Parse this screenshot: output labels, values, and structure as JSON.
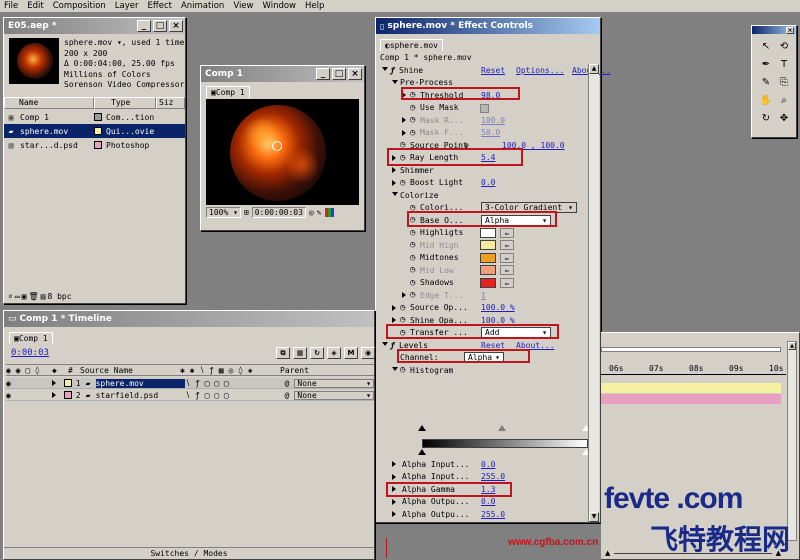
{
  "menu": [
    "File",
    "Edit",
    "Composition",
    "Layer",
    "Effect",
    "Animation",
    "View",
    "Window",
    "Help"
  ],
  "project": {
    "title": "E05.aep *",
    "info": [
      "sphere.mov ▾, used 1 time",
      "200 x 200",
      "Δ 0:00:04:00, 25.00 fps",
      "Millions of Colors",
      "Sorenson Video Compressor"
    ],
    "col_name": "Name",
    "col_type": "Type",
    "col_size": "Siz",
    "items": [
      {
        "name": "Comp 1",
        "type": "Com...tion",
        "swatch": "#9a9a9a"
      },
      {
        "name": "sphere.mov",
        "type": "Qui...ovie",
        "swatch": "#f5f0a0"
      },
      {
        "name": "star...d.psd",
        "type": "Photoshop",
        "swatch": "#e8a0c0"
      }
    ],
    "bpc": "8 bpc"
  },
  "comp": {
    "title": "Comp 1",
    "tab": "Comp 1",
    "zoom": "100%",
    "time": "0:00:00:03"
  },
  "effects": {
    "title": "sphere.mov * Effect Controls",
    "tab": "sphere.mov",
    "path": "Comp 1 * sphere.mov",
    "rows": [
      {
        "lvl": 0,
        "exp": "down",
        "fx": true,
        "label": "Shine",
        "links": [
          "Reset",
          "Options...",
          "About..."
        ]
      },
      {
        "lvl": 1,
        "exp": "down",
        "label": "Pre-Process"
      },
      {
        "lvl": 2,
        "exp": "right",
        "sw": true,
        "label": "Threshold",
        "value": "98.0",
        "vx": 88
      },
      {
        "lvl": 2,
        "sw": true,
        "label": "Use Mask",
        "check": true
      },
      {
        "lvl": 2,
        "exp": "right",
        "sw": true,
        "label": "Mask R...",
        "value": "100.0",
        "vx": 88,
        "dim": true
      },
      {
        "lvl": 2,
        "exp": "right",
        "sw": true,
        "label": "Mask F...",
        "value": "50.0",
        "vx": 88,
        "dim": true
      },
      {
        "lvl": 1,
        "sw": true,
        "label": "Source Point",
        "value": "100.0 , 100.0",
        "vx": 107,
        "cross": true
      },
      {
        "lvl": 1,
        "exp": "right",
        "sw": true,
        "label": "Ray Length",
        "value": "5.4",
        "vx": 88
      },
      {
        "lvl": 1,
        "exp": "right",
        "label": "Shimmer"
      },
      {
        "lvl": 1,
        "exp": "right",
        "sw": true,
        "label": "Boost Light",
        "value": "0.0",
        "vx": 88
      },
      {
        "lvl": 1,
        "exp": "down",
        "label": "Colorize"
      },
      {
        "lvl": 2,
        "sw": true,
        "label": "Colori...",
        "dd": "3-Color Gradient",
        "ddw": 96
      },
      {
        "lvl": 2,
        "sw": true,
        "label": "Base O...",
        "dd": "Alpha",
        "ddw": 70
      },
      {
        "lvl": 2,
        "sw": true,
        "label": "Highligts",
        "color": "#ffffff"
      },
      {
        "lvl": 2,
        "sw": true,
        "label": "Mid High",
        "color": "#f8e8a0",
        "dim": true
      },
      {
        "lvl": 2,
        "sw": true,
        "label": "Midtones",
        "color": "#f0a020"
      },
      {
        "lvl": 2,
        "sw": true,
        "label": "Mid Low",
        "color": "#f0a078",
        "dim": true
      },
      {
        "lvl": 2,
        "sw": true,
        "label": "Shadows",
        "color": "#e82020"
      },
      {
        "lvl": 2,
        "exp": "right",
        "sw": true,
        "label": "Edge T...",
        "value": "1",
        "vx": 88,
        "dim": true
      },
      {
        "lvl": 1,
        "exp": "right",
        "sw": true,
        "label": "Source Op...",
        "value": "100.0 %",
        "vx": 88
      },
      {
        "lvl": 1,
        "exp": "right",
        "sw": true,
        "label": "Shine Opa...",
        "value": "100.0 %",
        "vx": 88
      },
      {
        "lvl": 1,
        "sw": true,
        "label": "Transfer ...",
        "dd": "Add",
        "ddw": 70
      },
      {
        "lvl": 0,
        "exp": "down",
        "fx": true,
        "label": "Levels",
        "links": [
          "Reset",
          "About..."
        ]
      },
      {
        "lvl": 1,
        "label": "Channel:",
        "dd": "Alpha",
        "ddw": 40,
        "ddx": 88
      },
      {
        "lvl": 1,
        "exp": "down",
        "sw": true,
        "label": "Histogram"
      }
    ],
    "bottom_rows": [
      {
        "label": "Alpha Input...",
        "value": "0.0"
      },
      {
        "label": "Alpha Input...",
        "value": "255.0"
      },
      {
        "label": "Alpha Gamma",
        "value": "1.3"
      },
      {
        "label": "Alpha Outpu...",
        "value": "0.0"
      },
      {
        "label": "Alpha Outpu...",
        "value": "255.0"
      }
    ]
  },
  "timeline": {
    "title": "Comp 1 * Timeline",
    "tab": "Comp 1",
    "time": "0:00:03",
    "col_num": "#",
    "col_source": "Source Name",
    "col_parent": "Parent",
    "layers": [
      {
        "num": "1",
        "name": "sphere.mov",
        "parent": "None",
        "color": "#f5f0a0"
      },
      {
        "num": "2",
        "name": "starfield.psd",
        "parent": "None",
        "color": "#e8a0c0"
      }
    ],
    "ruler": [
      "06s",
      "07s",
      "08s",
      "09s",
      "10s"
    ],
    "switches": "Switches / Modes"
  },
  "watermark": {
    "logo": "fevte .com",
    "chinese": "飞特教程网",
    "url": "www.cgfba.com.cn"
  },
  "tools": [
    "arrow-icon",
    "rotate-icon",
    "pen-icon",
    "text-icon",
    "brush-icon",
    "clone-icon",
    "hand-icon",
    "zoom-icon",
    "orbit-icon",
    "track-icon"
  ],
  "colors": {
    "accent": "#c0141c",
    "value": "#2020c0"
  }
}
